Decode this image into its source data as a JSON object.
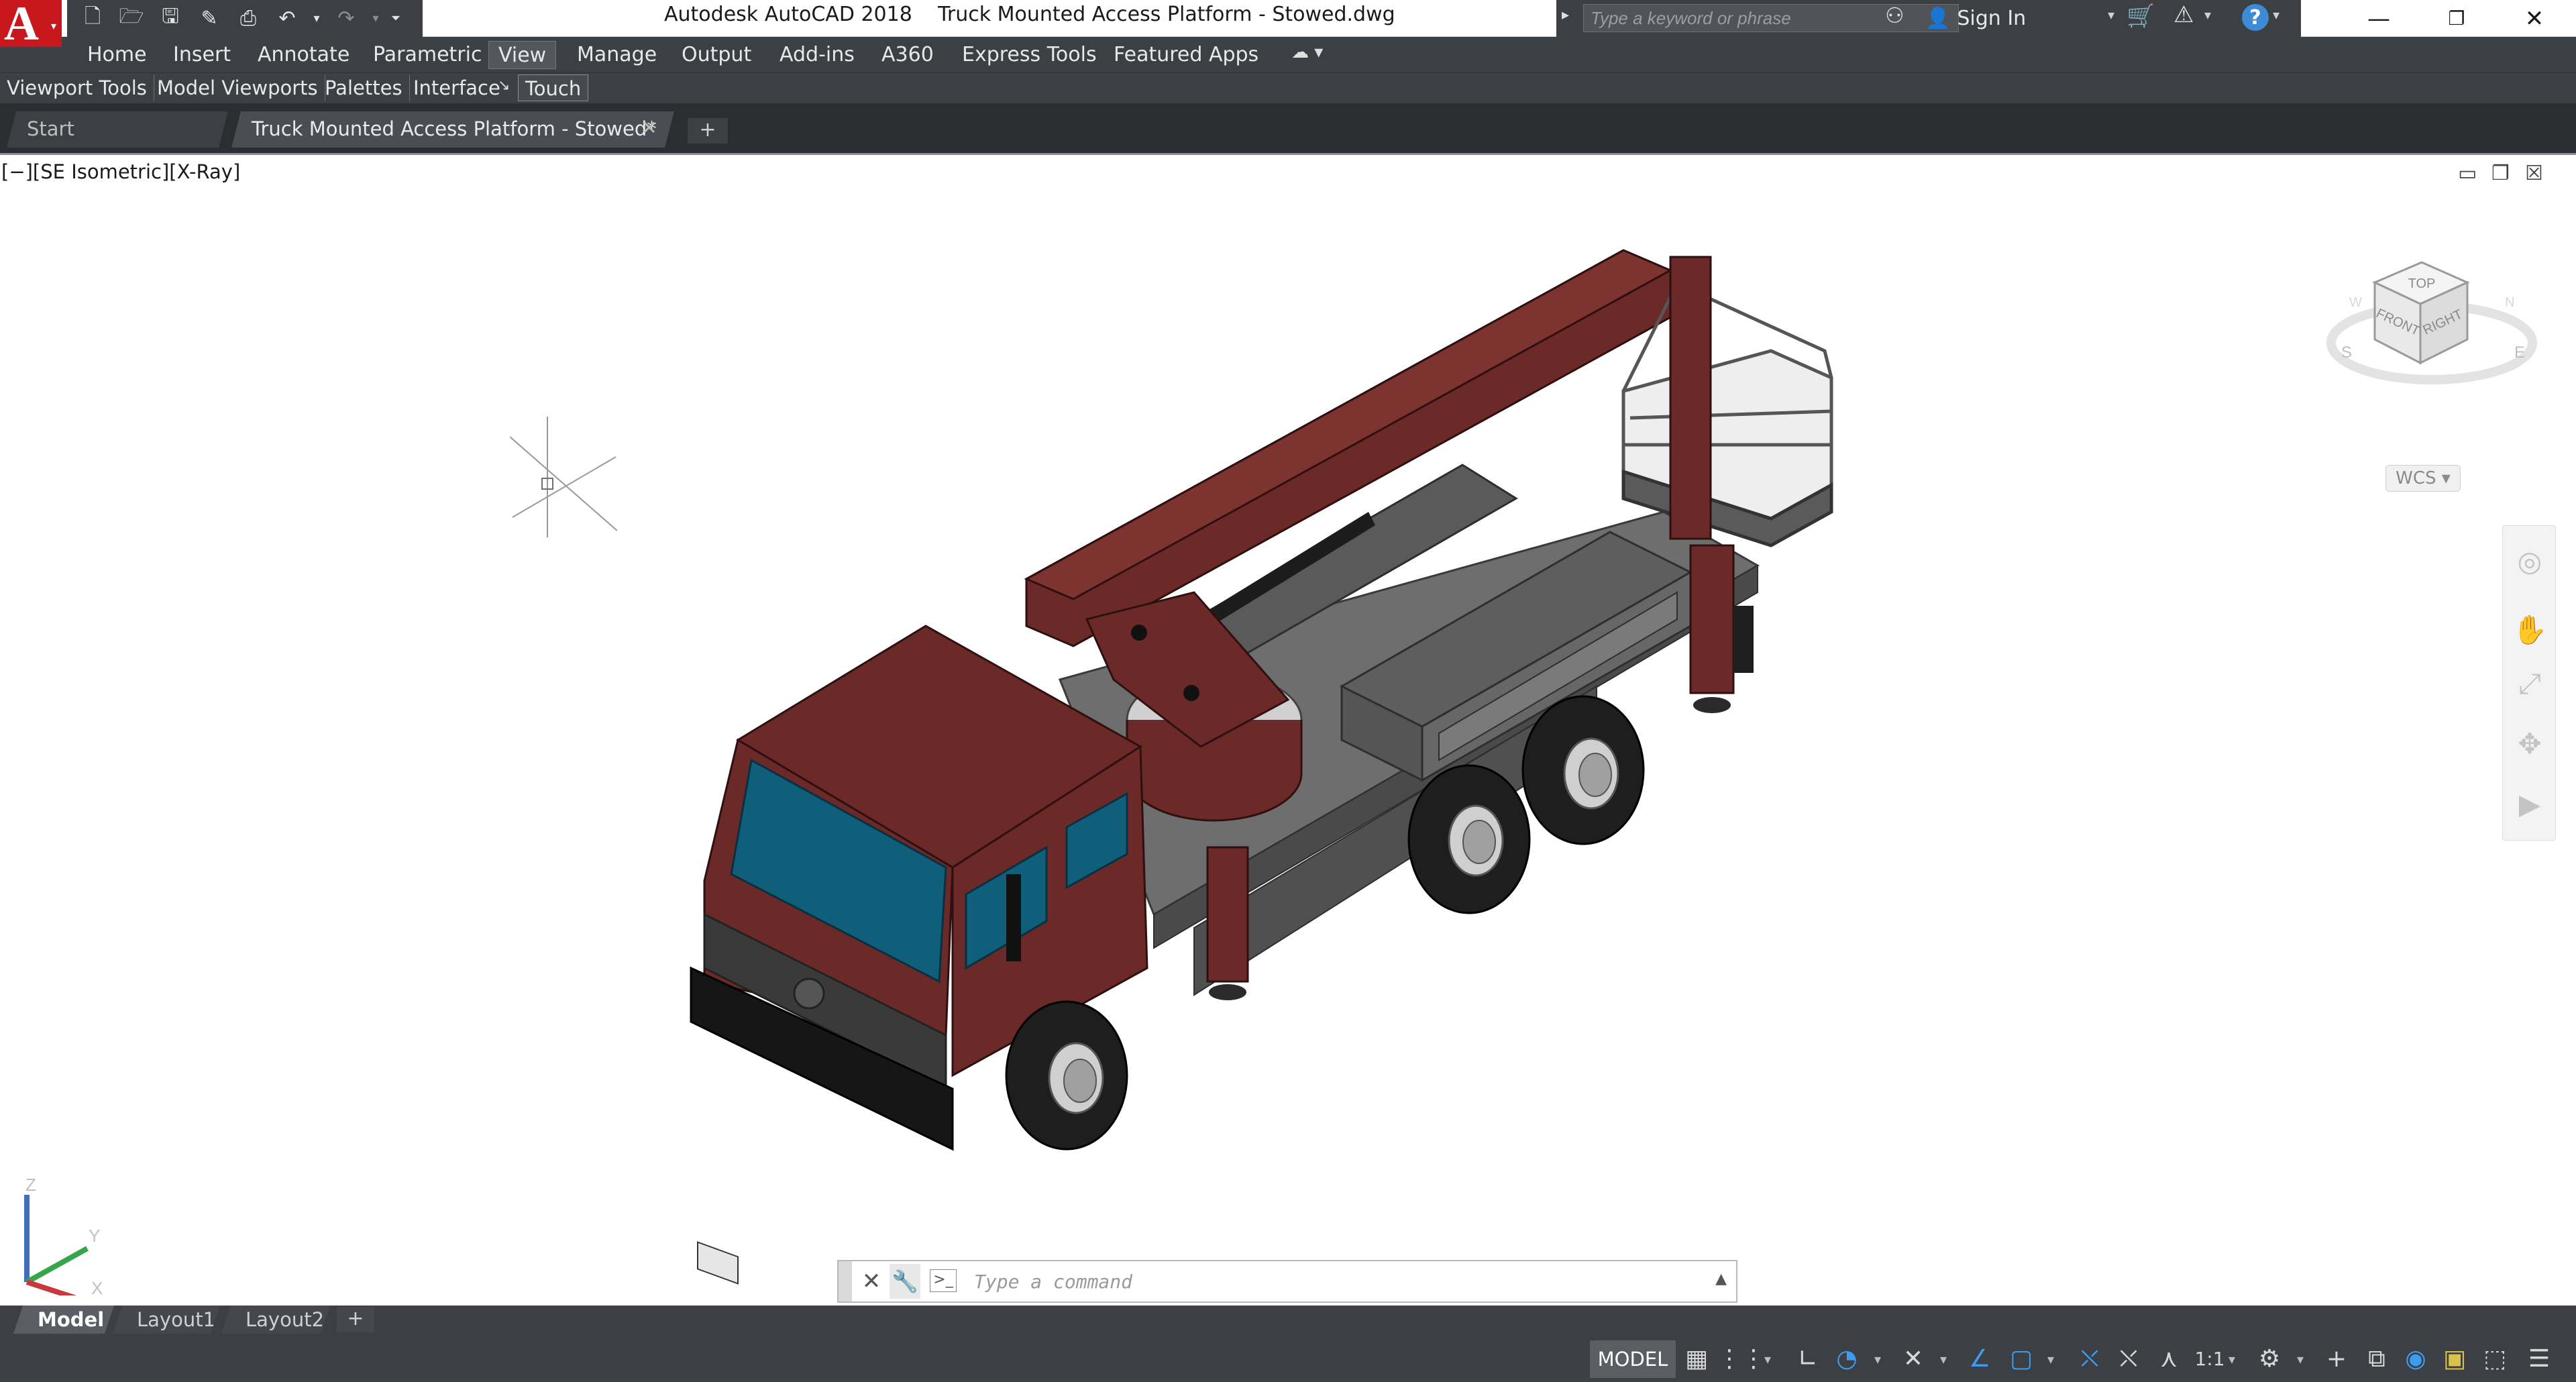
{
  "title_bar": {
    "app_logo": "A",
    "title": "Autodesk AutoCAD 2018    Truck Mounted Access Platform - Stowed.dwg",
    "search_placeholder": "Type a keyword or phrase",
    "sign_in": "Sign In",
    "quick_access_icons": [
      "new-icon",
      "open-icon",
      "save-icon",
      "save-as-icon",
      "plot-icon",
      "undo-icon",
      "redo-icon",
      "customize-icon"
    ]
  },
  "menu": {
    "tabs": [
      "Home",
      "Insert",
      "Annotate",
      "Parametric",
      "View",
      "Manage",
      "Output",
      "Add-ins",
      "A360",
      "Express Tools",
      "Featured Apps"
    ],
    "active": "View"
  },
  "panels": {
    "items": [
      "Viewport Tools",
      "Model Viewports",
      "Palettes",
      "Interface",
      "Touch"
    ],
    "active": "Touch"
  },
  "doc_tabs": {
    "start": "Start",
    "drawing": "Truck Mounted Access Platform - Stowed*",
    "add": "+"
  },
  "viewport": {
    "label": "[−][SE Isometric][X-Ray]",
    "viewcube_faces": {
      "top": "TOP",
      "front": "FRONT",
      "right": "RIGHT"
    },
    "compass": {
      "s": "S",
      "e": "E",
      "w": "W",
      "n": "N"
    },
    "wcs": "WCS",
    "ucs_axes": {
      "z": "Z",
      "y": "Y",
      "x": "X"
    },
    "colors": {
      "body": "#6b2a28",
      "glass": "#0f5f7a",
      "grey": "#6e6e6e",
      "dark": "#2a2a2a"
    }
  },
  "command_line": {
    "placeholder": "Type a command",
    "close": "✕",
    "settings": "🔧"
  },
  "layout_tabs": {
    "tabs": [
      "Model",
      "Layout1",
      "Layout2"
    ],
    "active": "Model",
    "add": "+"
  },
  "status_bar": {
    "model": "MODEL",
    "scale": "1:1"
  }
}
